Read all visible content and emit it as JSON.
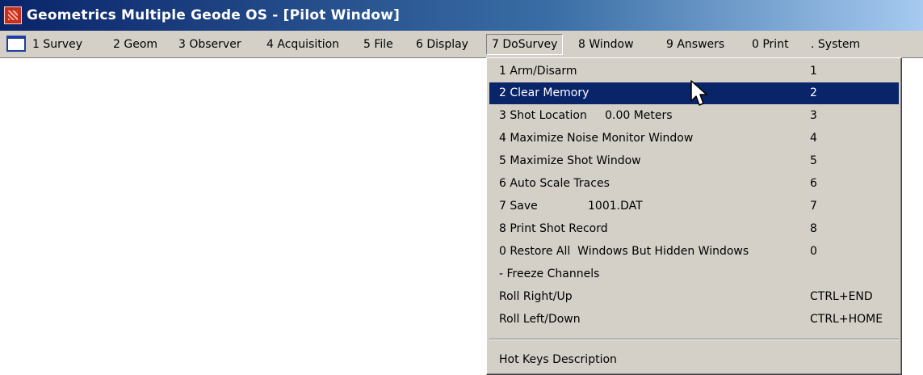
{
  "window": {
    "title": "Geometrics Multiple Geode OS - [Pilot Window]"
  },
  "menubar": {
    "items": [
      {
        "label": "1 Survey"
      },
      {
        "label": "2 Geom"
      },
      {
        "label": "3 Observer"
      },
      {
        "label": "4 Acquisition"
      },
      {
        "label": "5 File"
      },
      {
        "label": "6 Display"
      },
      {
        "label": "7 DoSurvey"
      },
      {
        "label": "8 Window"
      },
      {
        "label": "9 Answers"
      },
      {
        "label": "0 Print"
      },
      {
        "label": ". System"
      }
    ],
    "active_item": "7 DoSurvey"
  },
  "dropdown": {
    "items": [
      {
        "label": "1 Arm/Disarm",
        "hotkey": "1"
      },
      {
        "label": "2 Clear Memory",
        "hotkey": "2",
        "selected": true
      },
      {
        "label": "3 Shot Location     0.00 Meters",
        "hotkey": "3"
      },
      {
        "label": "4 Maximize Noise Monitor Window",
        "hotkey": "4"
      },
      {
        "label": "5 Maximize Shot Window",
        "hotkey": "5"
      },
      {
        "label": "6 Auto Scale Traces",
        "hotkey": "6"
      },
      {
        "label": "7 Save              1001.DAT",
        "hotkey": "7"
      },
      {
        "label": "8 Print Shot Record",
        "hotkey": "8"
      },
      {
        "label": "0 Restore All  Windows But Hidden Windows",
        "hotkey": "0"
      },
      {
        "label": "- Freeze Channels",
        "hotkey": ""
      },
      {
        "label": "Roll Right/Up",
        "hotkey": "CTRL+END"
      },
      {
        "label": "Roll Left/Down",
        "hotkey": "CTRL+HOME"
      }
    ],
    "footer_item": {
      "label": "Hot Keys Description"
    }
  },
  "icons": {
    "app": "geode-app-icon",
    "document": "mdi-document-icon",
    "cursor": "mouse-pointer-icon"
  },
  "colors": {
    "titlebar_start": "#0a246a",
    "titlebar_end": "#a6caf0",
    "menu_background": "#d4d0c8",
    "selection": "#0a246a"
  }
}
